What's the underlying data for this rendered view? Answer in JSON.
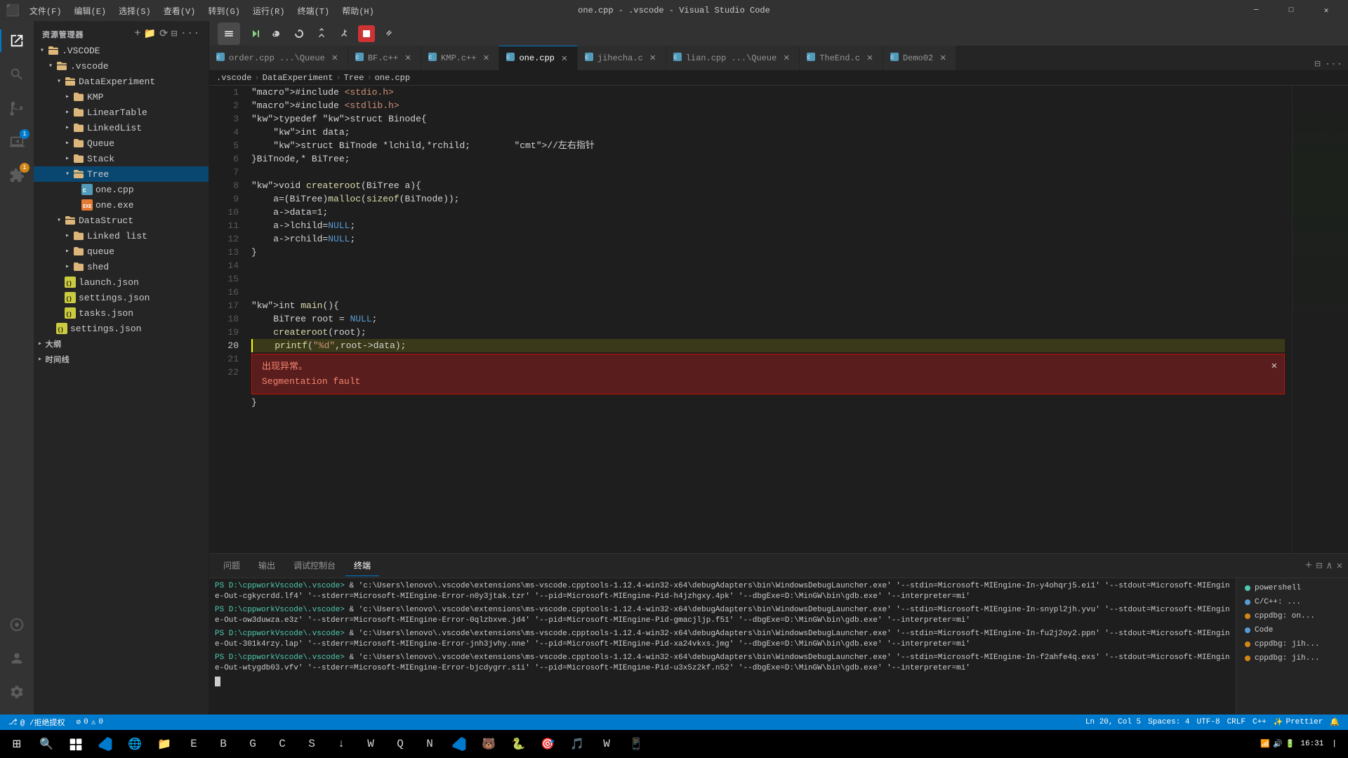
{
  "titleBar": {
    "title": "one.cpp - .vscode - Visual Studio Code",
    "menus": [
      "文件(F)",
      "编辑(E)",
      "选择(S)",
      "查看(V)",
      "转到(G)",
      "运行(R)",
      "终端(T)",
      "帮助(H)"
    ],
    "controls": [
      "─",
      "□",
      "✕"
    ]
  },
  "activityBar": {
    "icons": [
      {
        "name": "explorer",
        "symbol": "⬛",
        "active": true
      },
      {
        "name": "search",
        "symbol": "🔍"
      },
      {
        "name": "source-control",
        "symbol": "⎇"
      },
      {
        "name": "run",
        "symbol": "▷",
        "badge": "1"
      },
      {
        "name": "extensions",
        "symbol": "⊞",
        "badge": "1"
      },
      {
        "name": "remote",
        "symbol": "⊹"
      }
    ],
    "bottom": [
      {
        "name": "accounts",
        "symbol": "👤"
      },
      {
        "name": "settings",
        "symbol": "⚙"
      }
    ]
  },
  "sidebar": {
    "header": "资源管理器",
    "tree": [
      {
        "id": "vscode-root",
        "label": ".VSCODE",
        "level": 0,
        "type": "folder",
        "open": true
      },
      {
        "id": "vscode-dir",
        "label": ".vscode",
        "level": 1,
        "type": "folder",
        "open": true
      },
      {
        "id": "dataexperiment",
        "label": "DataExperiment",
        "level": 2,
        "type": "folder",
        "open": true
      },
      {
        "id": "kmp",
        "label": "KMP",
        "level": 3,
        "type": "folder"
      },
      {
        "id": "lineartable",
        "label": "LinearTable",
        "level": 3,
        "type": "folder"
      },
      {
        "id": "linkedlist",
        "label": "LinkedList",
        "level": 3,
        "type": "folder"
      },
      {
        "id": "queue",
        "label": "Queue",
        "level": 3,
        "type": "folder"
      },
      {
        "id": "stack",
        "label": "Stack",
        "level": 3,
        "type": "folder"
      },
      {
        "id": "tree",
        "label": "Tree",
        "level": 3,
        "type": "folder",
        "open": true,
        "selected": true
      },
      {
        "id": "one-cpp",
        "label": "one.cpp",
        "level": 4,
        "type": "file-cpp"
      },
      {
        "id": "one-exe",
        "label": "one.exe",
        "level": 4,
        "type": "file-exe"
      },
      {
        "id": "datastruct",
        "label": "DataStruct",
        "level": 2,
        "type": "folder",
        "open": true
      },
      {
        "id": "linkedlist2",
        "label": "Linked list",
        "level": 3,
        "type": "folder"
      },
      {
        "id": "queue2",
        "label": "queue",
        "level": 3,
        "type": "folder"
      },
      {
        "id": "shed",
        "label": "shed",
        "level": 3,
        "type": "folder"
      },
      {
        "id": "launch-json",
        "label": "launch.json",
        "level": 2,
        "type": "file-json"
      },
      {
        "id": "settings-json",
        "label": "settings.json",
        "level": 2,
        "type": "file-json"
      },
      {
        "id": "tasks-json",
        "label": "tasks.json",
        "level": 2,
        "type": "file-json"
      },
      {
        "id": "settings-root-json",
        "label": "settings.json",
        "level": 1,
        "type": "file-json"
      }
    ],
    "sections": [
      {
        "label": "▸ 大纲"
      },
      {
        "label": "▸ 时间线"
      }
    ]
  },
  "tabs": [
    {
      "label": "order.cpp",
      "sublabel": "...\\Queue",
      "active": false,
      "icon": "C"
    },
    {
      "label": "BF.c++",
      "active": false,
      "icon": "C"
    },
    {
      "label": "KMP.c++",
      "active": false,
      "icon": "C"
    },
    {
      "label": "one.cpp",
      "active": true,
      "icon": "C"
    },
    {
      "label": "jihecha.c",
      "active": false,
      "icon": "C"
    },
    {
      "label": "lian.cpp",
      "sublabel": "...\\Queue",
      "active": false,
      "icon": "C"
    },
    {
      "label": "TheEnd.c",
      "active": false,
      "icon": "C"
    },
    {
      "label": "Demo02",
      "active": false,
      "icon": "C"
    }
  ],
  "breadcrumb": [
    ".vscode",
    "DataExperiment",
    "Tree",
    "one.cpp"
  ],
  "code": {
    "lines": [
      {
        "num": 1,
        "content": "#include <stdio.h>"
      },
      {
        "num": 2,
        "content": "#include <stdlib.h>"
      },
      {
        "num": 3,
        "content": "typedef struct Binode{"
      },
      {
        "num": 4,
        "content": "    int data;"
      },
      {
        "num": 5,
        "content": "    struct BiTnode *lchild,*rchild;        //左右指针"
      },
      {
        "num": 6,
        "content": "}BiTnode,* BiTree;"
      },
      {
        "num": 7,
        "content": ""
      },
      {
        "num": 8,
        "content": "void createroot(BiTree a){"
      },
      {
        "num": 9,
        "content": "    a=(BiTree)malloc(sizeof(BiTnode));"
      },
      {
        "num": 10,
        "content": "    a->data=1;"
      },
      {
        "num": 11,
        "content": "    a->lchild=NULL;"
      },
      {
        "num": 12,
        "content": "    a->rchild=NULL;"
      },
      {
        "num": 13,
        "content": "}"
      },
      {
        "num": 14,
        "content": ""
      },
      {
        "num": 15,
        "content": ""
      },
      {
        "num": 16,
        "content": ""
      },
      {
        "num": 17,
        "content": "int main(){"
      },
      {
        "num": 18,
        "content": "    BiTree root = NULL;"
      },
      {
        "num": 19,
        "content": "    createroot(root);"
      },
      {
        "num": 20,
        "content": "    printf(\"%d\",root->data);",
        "debug": true
      },
      {
        "num": 21,
        "content": "}"
      },
      {
        "num": 22,
        "content": ""
      }
    ]
  },
  "errorPopup": {
    "title": "出现异常。",
    "message": "Segmentation fault"
  },
  "panel": {
    "tabs": [
      "问题",
      "输出",
      "调试控制台",
      "终端"
    ],
    "activeTab": "终端",
    "terminalLines": [
      "PS D:\\cppworkVscode\\.vscode> & 'c:\\Users\\lenovo\\.vscode\\extensions\\ms-vscode.cpptools-1.12.4-win32-x64\\debugAdapters\\bin\\WindowsDebugLauncher.exe' '--stdin=Microsoft-MIEngine-In-y4ohqrj5.ei1' '--stdout=Microsoft-MIEngine-Out-cgkycrdd.lf4' '--stderr=Microsoft-MIEngine-Error-n0y3jtak.tzr' '--pid=Microsoft-MIEngine-Pid-h4jzhgxy.4pk' '--dbgExe=D:\\MinGW\\bin\\gdb.exe' '--interpreter=mi'",
      "PS D:\\cppworkVscode\\.vscode> & 'c:\\Users\\lenovo\\.vscode\\extensions\\ms-vscode.cpptools-1.12.4-win32-x64\\debugAdapters\\bin\\WindowsDebugLauncher.exe' '--stdin=Microsoft-MIEngine-In-snypl2jh.yvu' '--stdout=Microsoft-MIEngine-Out-ow3duwza.e3z' '--stderr=Microsoft-MIEngine-Error-0qlzbxve.jd4' '--pid=Microsoft-MIEngine-Pid-gmacjljp.f51' '--dbgExe=D:\\MinGW\\bin\\gdb.exe' '--interpreter=mi'",
      "PS D:\\cppworkVscode\\.vscode> & 'c:\\Users\\lenovo\\.vscode\\extensions\\ms-vscode.cpptools-1.12.4-win32-x64\\debugAdapters\\bin\\WindowsDebugLauncher.exe' '--stdin=Microsoft-MIEngine-In-fu2j2oy2.ppn' '--stdout=Microsoft-MIEngine-Out-301k4rzy.lap' '--stderr=Microsoft-MIEngine-Error-jnh3jvhy.nne' '--pid=Microsoft-MIEngine-Pid-xa24vkxs.jmg' '--dbgExe=D:\\MinGW\\bin\\gdb.exe' '--interpreter=mi'",
      "PS D:\\cppworkVscode\\.vscode> & 'c:\\Users\\lenovo\\.vscode\\extensions\\ms-vscode.cpptools-1.12.4-win32-x64\\debugAdapters\\bin\\WindowsDebugLauncher.exe' '--stdin=Microsoft-MIEngine-In-f2ahfe4q.exs' '--stdout=Microsoft-MIEngine-Out-wtygdb03.vfv' '--stderr=Microsoft-MIEngine-Error-bjcdygrr.s1i' '--pid=Microsoft-MIEngine-Pid-u3x5z2kf.n52' '--dbgExe=D:\\MinGW\\bin\\gdb.exe' '--interpreter=mi'"
    ],
    "rightTabs": [
      "powershell",
      "C/C++: ...",
      "cppdbg: on...",
      "Code",
      "cppdbg: jih...",
      "cppdbg: jih..."
    ]
  },
  "statusBar": {
    "left": [
      {
        "icon": "⎇",
        "text": "@ /拒绝提权"
      },
      {
        "icon": "",
        "text": "0 ⚠ 0"
      },
      {
        "icon": "",
        "text": "Ln 20, Col 5"
      },
      {
        "icon": "",
        "text": "Spaces: 4"
      },
      {
        "icon": "",
        "text": "UTF-8"
      },
      {
        "icon": "",
        "text": "CRLF"
      },
      {
        "icon": "",
        "text": "C++"
      },
      {
        "icon": "",
        "text": "Prettier"
      }
    ],
    "time": "16:31",
    "date": ""
  },
  "debugBar": {
    "buttons": [
      "▶",
      "↻",
      "↓",
      "↑",
      "→",
      "⬛",
      "↩"
    ]
  },
  "taskbar": {
    "apps": [
      "⊞",
      "🔍",
      "⬛",
      "🌐",
      "📁",
      "💻",
      "📝",
      "🔷",
      "⬛",
      "🔴",
      "🌍",
      "🎮",
      "💬",
      "📦",
      "🎵",
      "📧",
      "💠",
      "🐍",
      "📊",
      "🎯",
      "🔵",
      "⚙",
      "💡",
      "🗂"
    ],
    "systray": "16:31"
  }
}
